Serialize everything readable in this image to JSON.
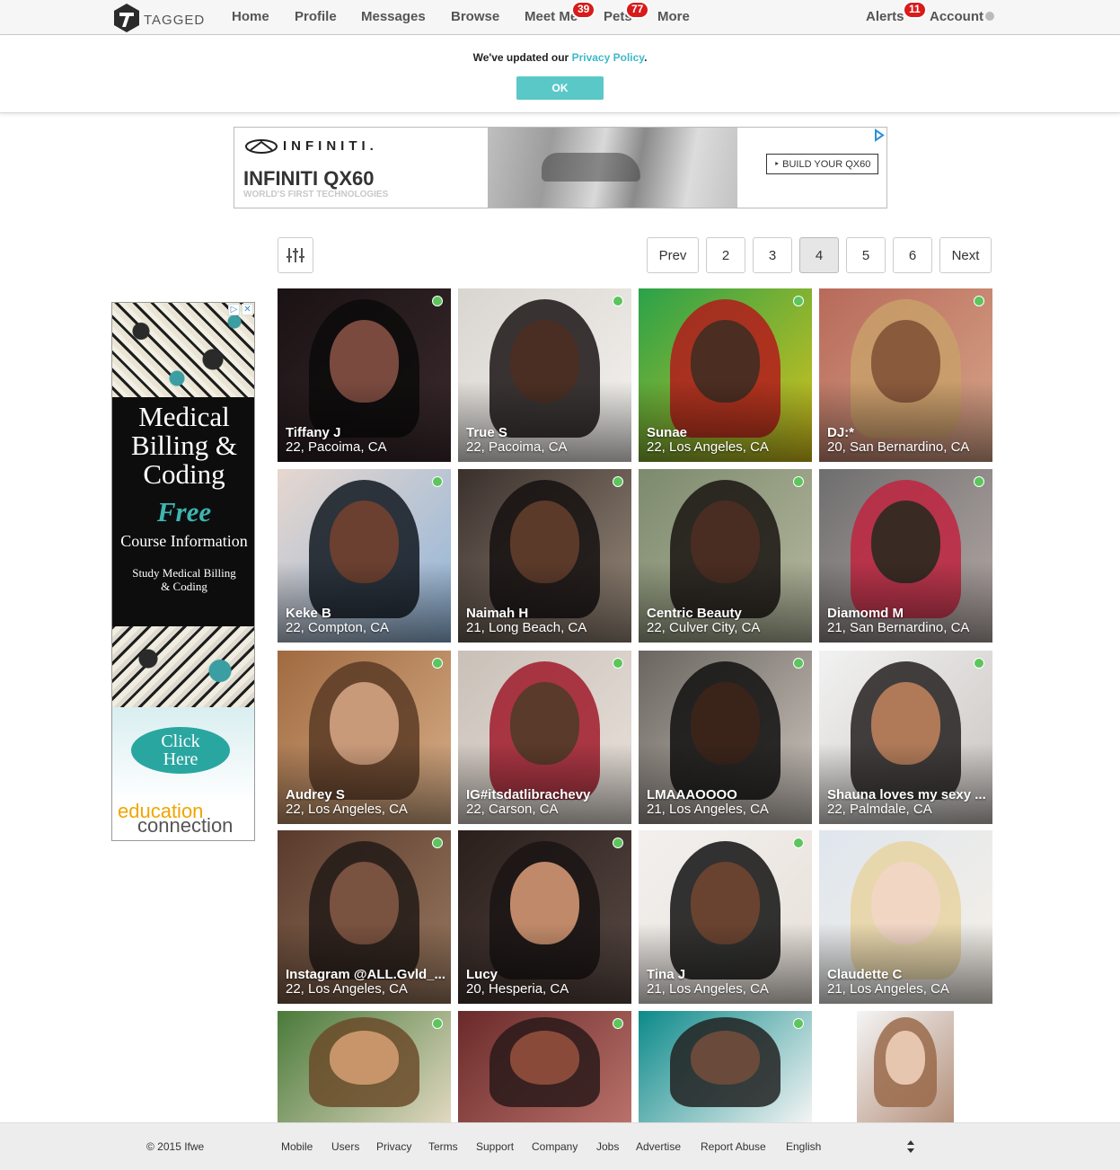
{
  "brand": {
    "name": "TAGGED"
  },
  "nav": {
    "items": [
      {
        "label": "Home"
      },
      {
        "label": "Profile"
      },
      {
        "label": "Messages"
      },
      {
        "label": "Browse"
      },
      {
        "label": "Meet Me",
        "badge": "39"
      },
      {
        "label": "Pets",
        "badge": "77"
      },
      {
        "label": "More"
      }
    ],
    "alerts": {
      "label": "Alerts",
      "badge": "11"
    },
    "account": {
      "label": "Account"
    }
  },
  "notice": {
    "text": "We've updated our",
    "link": "Privacy Policy",
    "period": ".",
    "ok_label": "OK"
  },
  "banner_ad": {
    "brand": "INFINITI.",
    "title": "INFINITI QX60",
    "subtitle": "WORLD'S FIRST TECHNOLOGIES",
    "cta": "‣ BUILD YOUR QX60"
  },
  "side_ad": {
    "headline_1": "Medical",
    "headline_2": "Billing &",
    "headline_3": "Coding",
    "free": "Free",
    "course": "Course Information",
    "study_1": "Study Medical Billing",
    "study_2": "& Coding",
    "click_1": "Click",
    "click_2": "Here",
    "logo_1": "education",
    "logo_2": "connection"
  },
  "pagination": {
    "prev": "Prev",
    "pages": [
      "2",
      "3",
      "4",
      "5",
      "6"
    ],
    "current": "4",
    "next": "Next"
  },
  "profiles": [
    {
      "name": "Tiffany J",
      "location": "22, Pacoima, CA",
      "online": true
    },
    {
      "name": "True S",
      "location": "22, Pacoima, CA",
      "online": true
    },
    {
      "name": "Sunae",
      "location": "22, Los Angeles, CA",
      "online": true
    },
    {
      "name": "DJ:*",
      "location": "20, San Bernardino, CA",
      "online": true
    },
    {
      "name": "Keke B",
      "location": "22, Compton, CA",
      "online": true
    },
    {
      "name": "Naimah H",
      "location": "21, Long Beach, CA",
      "online": true
    },
    {
      "name": "Centric Beauty",
      "location": "22, Culver City, CA",
      "online": true
    },
    {
      "name": "Diamomd M",
      "location": "21, San Bernardino, CA",
      "online": true
    },
    {
      "name": "Audrey S",
      "location": "22, Los Angeles, CA",
      "online": true
    },
    {
      "name": "IG#itsdatlibrachevy",
      "location": "22, Carson, CA",
      "online": true
    },
    {
      "name": "LMAAAOOOO",
      "location": "21, Los Angeles, CA",
      "online": true
    },
    {
      "name": "Shauna loves my sexy ...",
      "location": "22, Palmdale, CA",
      "online": true
    },
    {
      "name": "Instagram @ALL.Gvld_...",
      "location": "22, Los Angeles, CA",
      "online": true
    },
    {
      "name": "Lucy",
      "location": "20, Hesperia, CA",
      "online": true
    },
    {
      "name": "Tina J",
      "location": "21, Los Angeles, CA",
      "online": true
    },
    {
      "name": "Claudette C",
      "location": "21, Los Angeles, CA",
      "online": false
    },
    {
      "name": "",
      "location": "",
      "online": true
    },
    {
      "name": "",
      "location": "",
      "online": true
    },
    {
      "name": "",
      "location": "",
      "online": true
    },
    {
      "name": "",
      "location": "",
      "online": false
    }
  ],
  "footer": {
    "copyright": "© 2015 Ifwe",
    "links": [
      "Mobile",
      "Users",
      "Privacy",
      "Terms",
      "Support",
      "Company",
      "Jobs",
      "Advertise",
      "Report Abuse",
      "English"
    ]
  },
  "colors": {
    "accent": "#5bc8c8",
    "link": "#3fb8c8",
    "badge": "#d81b1b",
    "online": "#5cc55c"
  }
}
